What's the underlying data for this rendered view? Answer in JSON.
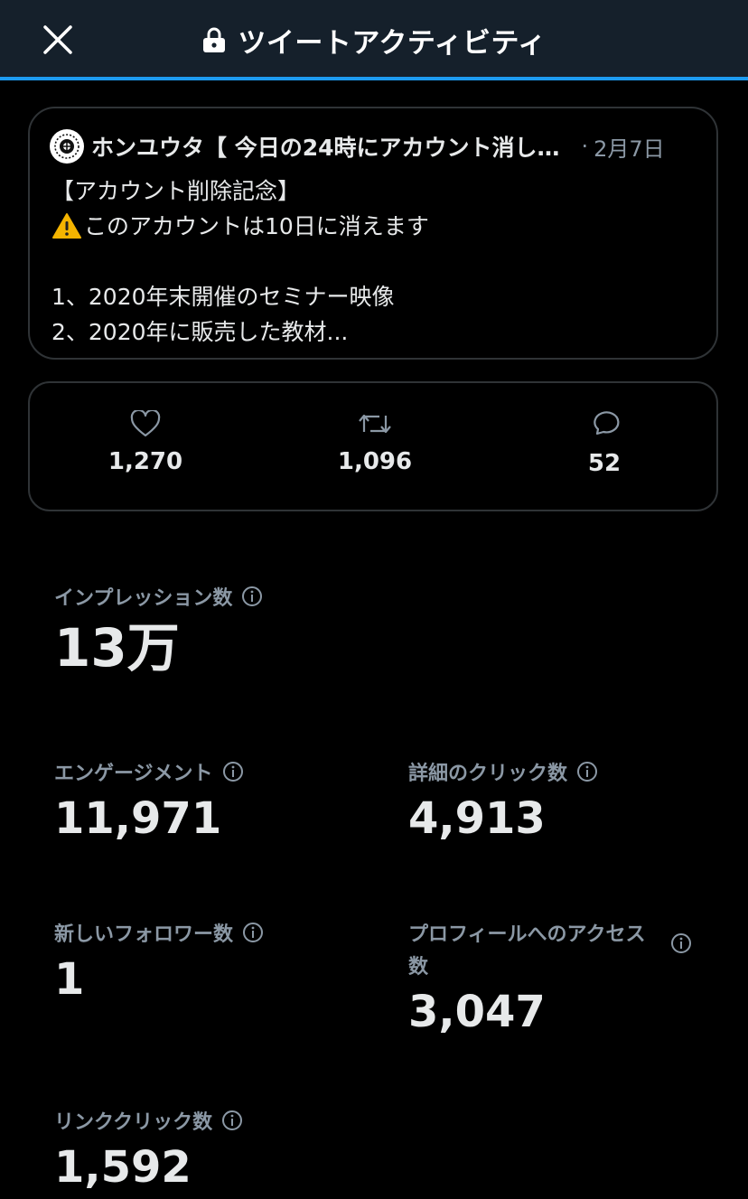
{
  "header": {
    "title": "ツイートアクティビティ",
    "close_icon": "close-icon",
    "lock_icon": "lock-icon",
    "accent_color": "#1d9bf0",
    "background": "#15202b"
  },
  "tweet": {
    "author": "ホンユウタ【 今日の24時にアカウント消し…",
    "separator": "·",
    "date": "2月7日",
    "lines": [
      "【アカウント削除記念】",
      "このアカウントは10日に消えます",
      "",
      "1、2020年末開催のセミナー映像",
      "2、2020年に販売した教材..."
    ],
    "warning_icon": "warning-icon"
  },
  "engagement": {
    "likes": "1,270",
    "retweets": "1,096",
    "replies": "52"
  },
  "metrics": {
    "impressions": {
      "label": "インプレッション数",
      "value": "13万"
    },
    "engagements": {
      "label": "エンゲージメント",
      "value": "11,971"
    },
    "detail_clicks": {
      "label": "詳細のクリック数",
      "value": "4,913"
    },
    "new_followers": {
      "label": "新しいフォロワー数",
      "value": "1"
    },
    "profile_access": {
      "label_line1": "プロフィールへのアクセス",
      "label_line2": "数",
      "value": "3,047"
    },
    "link_clicks": {
      "label": "リンククリック数",
      "value": "1,592"
    }
  }
}
